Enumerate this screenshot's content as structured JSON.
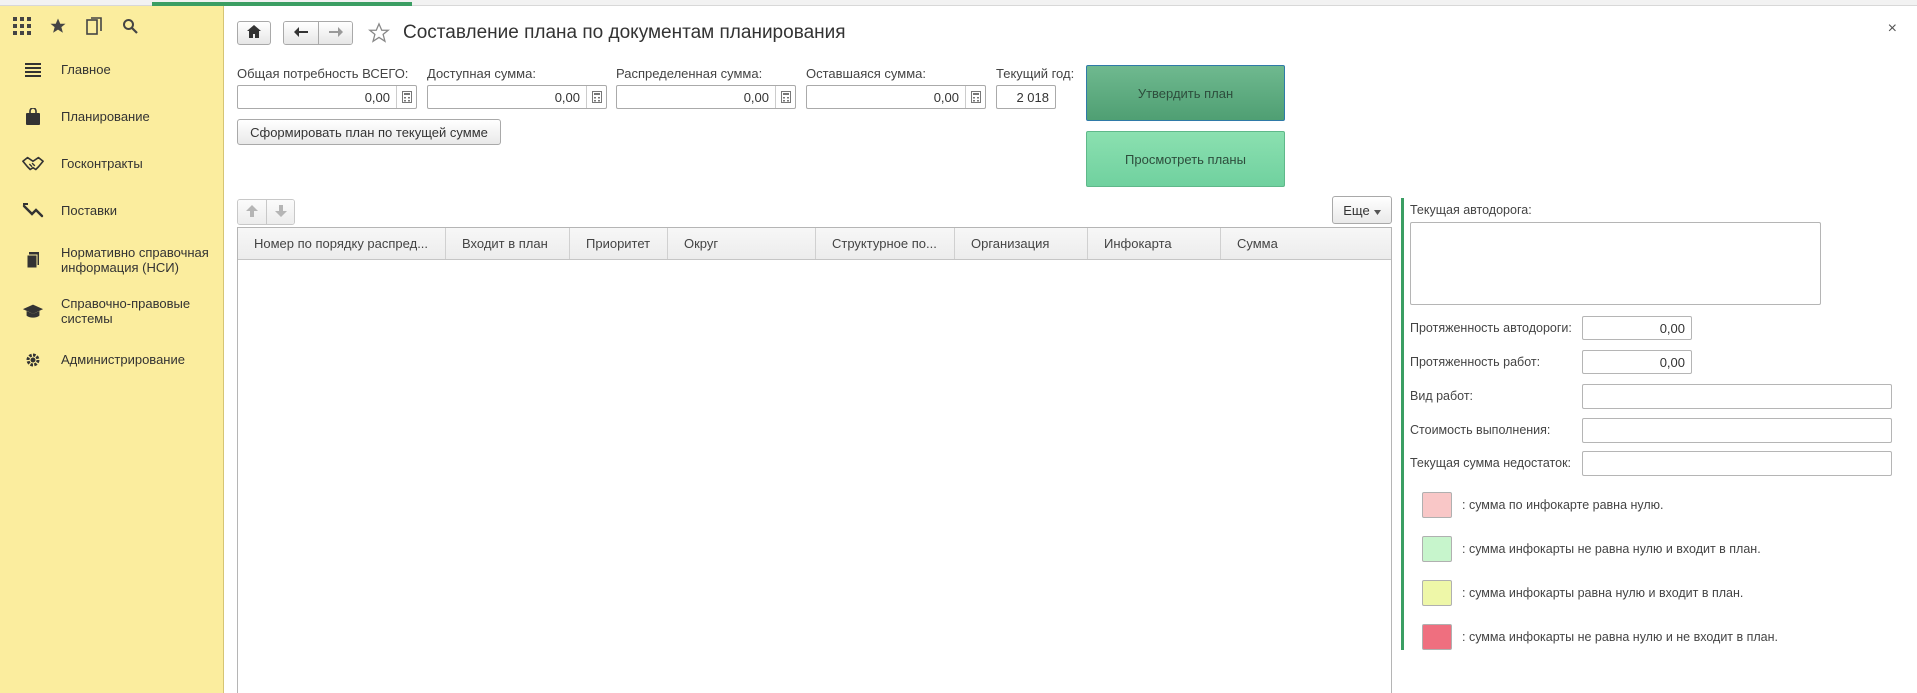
{
  "colors": {
    "sidebar_bg": "#fbed9e",
    "accent_green": "#3b9e63",
    "approve_btn": "#5aab7e",
    "view_btn": "#7fd9a7",
    "legend_pink": "#f9c7c7",
    "legend_light_green": "#c7f5cc",
    "legend_yellow": "#eef7a8",
    "legend_red": "#ef6f7f"
  },
  "sidebar": {
    "toolbar_icons": [
      "apps-grid-icon",
      "star-icon",
      "history-icon",
      "search-icon"
    ],
    "items": [
      {
        "label": "Главное",
        "icon": "menu-lines-icon"
      },
      {
        "label": "Планирование",
        "icon": "bag-icon"
      },
      {
        "label": "Госконтракты",
        "icon": "handshake-icon"
      },
      {
        "label": "Поставки",
        "icon": "truck-icon"
      },
      {
        "label": "Нормативно справочная информация (НСИ)",
        "icon": "books-icon"
      },
      {
        "label": "Справочно-правовые системы",
        "icon": "graduation-cap-icon"
      },
      {
        "label": "Администрирование",
        "icon": "gear-icon"
      }
    ]
  },
  "header": {
    "title": "Составление плана по документам планирования",
    "close": "×"
  },
  "fields": {
    "total_need": {
      "label": "Общая потребность ВСЕГО:",
      "value": "0,00"
    },
    "available": {
      "label": "Доступная сумма:",
      "value": "0,00"
    },
    "distributed": {
      "label": "Распределенная сумма:",
      "value": "0,00"
    },
    "remaining": {
      "label": "Оставшаяся сумма:",
      "value": "0,00"
    },
    "current_year": {
      "label": "Текущий год:",
      "value": "2 018"
    }
  },
  "buttons": {
    "form_plan": "Сформировать план по текущей сумме",
    "approve_plan": "Утвердить план",
    "view_plans": "Просмотреть планы",
    "more": "Еще"
  },
  "table": {
    "columns": [
      "Номер по порядку распред...",
      "Входит в план",
      "Приоритет",
      "Округ",
      "Структурное по...",
      "Организация",
      "Инфокарта",
      "Сумма"
    ]
  },
  "details": {
    "current_road_label": "Текущая автодорога:",
    "road_length_label": "Протяженность автодороги:",
    "road_length_value": "0,00",
    "work_length_label": "Протяженность работ:",
    "work_length_value": "0,00",
    "work_type_label": "Вид работ:",
    "cost_label": "Стоимость выполнения:",
    "shortage_label": "Текущая сумма недостаток:"
  },
  "legend": [
    {
      "text": ": сумма по инфокарте равна нулю.",
      "color": "#f9c7c7"
    },
    {
      "text": ": сумма инфокарты не равна нулю и входит в план.",
      "color": "#c7f5cc"
    },
    {
      "text": ": сумма инфокарты равна нулю и входит в план.",
      "color": "#eef7a8"
    },
    {
      "text": ": сумма инфокарты не равна нулю и не входит в план.",
      "color": "#ef6f7f"
    }
  ]
}
